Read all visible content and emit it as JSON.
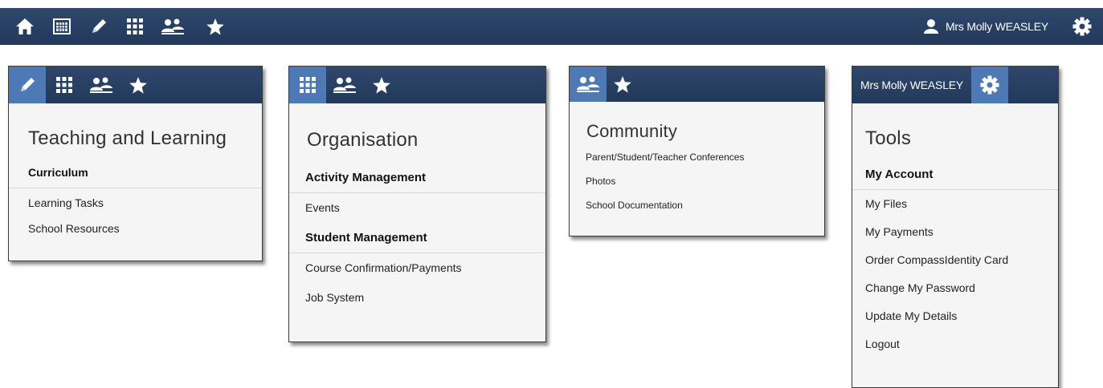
{
  "topbar": {
    "user_name": "Mrs Molly WEASLEY",
    "icons": [
      "home-icon",
      "calendar-icon",
      "pencil-icon",
      "grid-icon",
      "people-icon",
      "star-icon",
      "user-icon",
      "gear-icon"
    ]
  },
  "panels": {
    "teaching": {
      "title": "Teaching and Learning",
      "section": "Curriculum",
      "items": [
        "Learning Tasks",
        "School Resources"
      ]
    },
    "organisation": {
      "title": "Organisation",
      "sections": [
        {
          "heading": "Activity Management",
          "items": [
            "Events"
          ]
        },
        {
          "heading": "Student Management",
          "items": [
            "Course Confirmation/Payments",
            "Job System"
          ]
        }
      ]
    },
    "community": {
      "title": "Community",
      "items": [
        "Parent/Student/Teacher Conferences",
        "Photos",
        "School Documentation"
      ]
    },
    "tools": {
      "user_name": "Mrs Molly WEASLEY",
      "title": "Tools",
      "section": "My Account",
      "items": [
        "My Files",
        "My Payments",
        "Order CompassIdentity Card",
        "Change My Password",
        "Update My Details",
        "Logout"
      ]
    }
  },
  "colors": {
    "nav_bg": "#2a4266",
    "active_tab": "#4f79b5",
    "panel_bg": "#f5f5f5"
  }
}
